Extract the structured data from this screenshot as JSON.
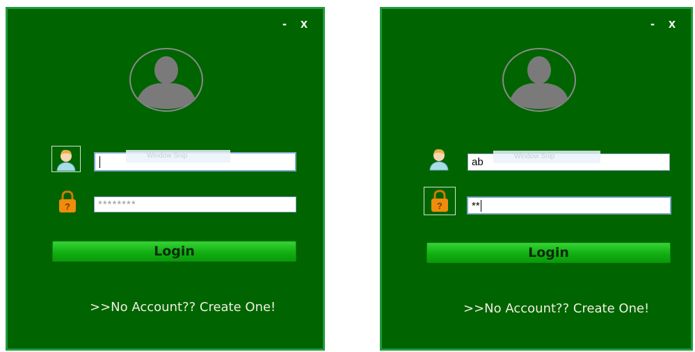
{
  "windows": [
    {
      "minimize_label": "-",
      "close_label": "x",
      "username": {
        "value": "",
        "hint": "Window Snip",
        "focused": true
      },
      "password": {
        "value": "********",
        "focused": false
      },
      "login_label": "Login",
      "create_link": ">>No Account??  Create One!"
    },
    {
      "minimize_label": "-",
      "close_label": "x",
      "username": {
        "value": "ab",
        "hint": "Window Snip",
        "focused": false
      },
      "password": {
        "value": "**",
        "focused": true
      },
      "login_label": "Login",
      "create_link": ">>No Account??  Create One!"
    }
  ],
  "colors": {
    "background": "#006400",
    "border": "#1f9b3c",
    "button": "#12b012",
    "lock": "#f08c0c"
  },
  "icons": [
    "user-avatar-icon",
    "user-field-icon",
    "lock-icon"
  ]
}
